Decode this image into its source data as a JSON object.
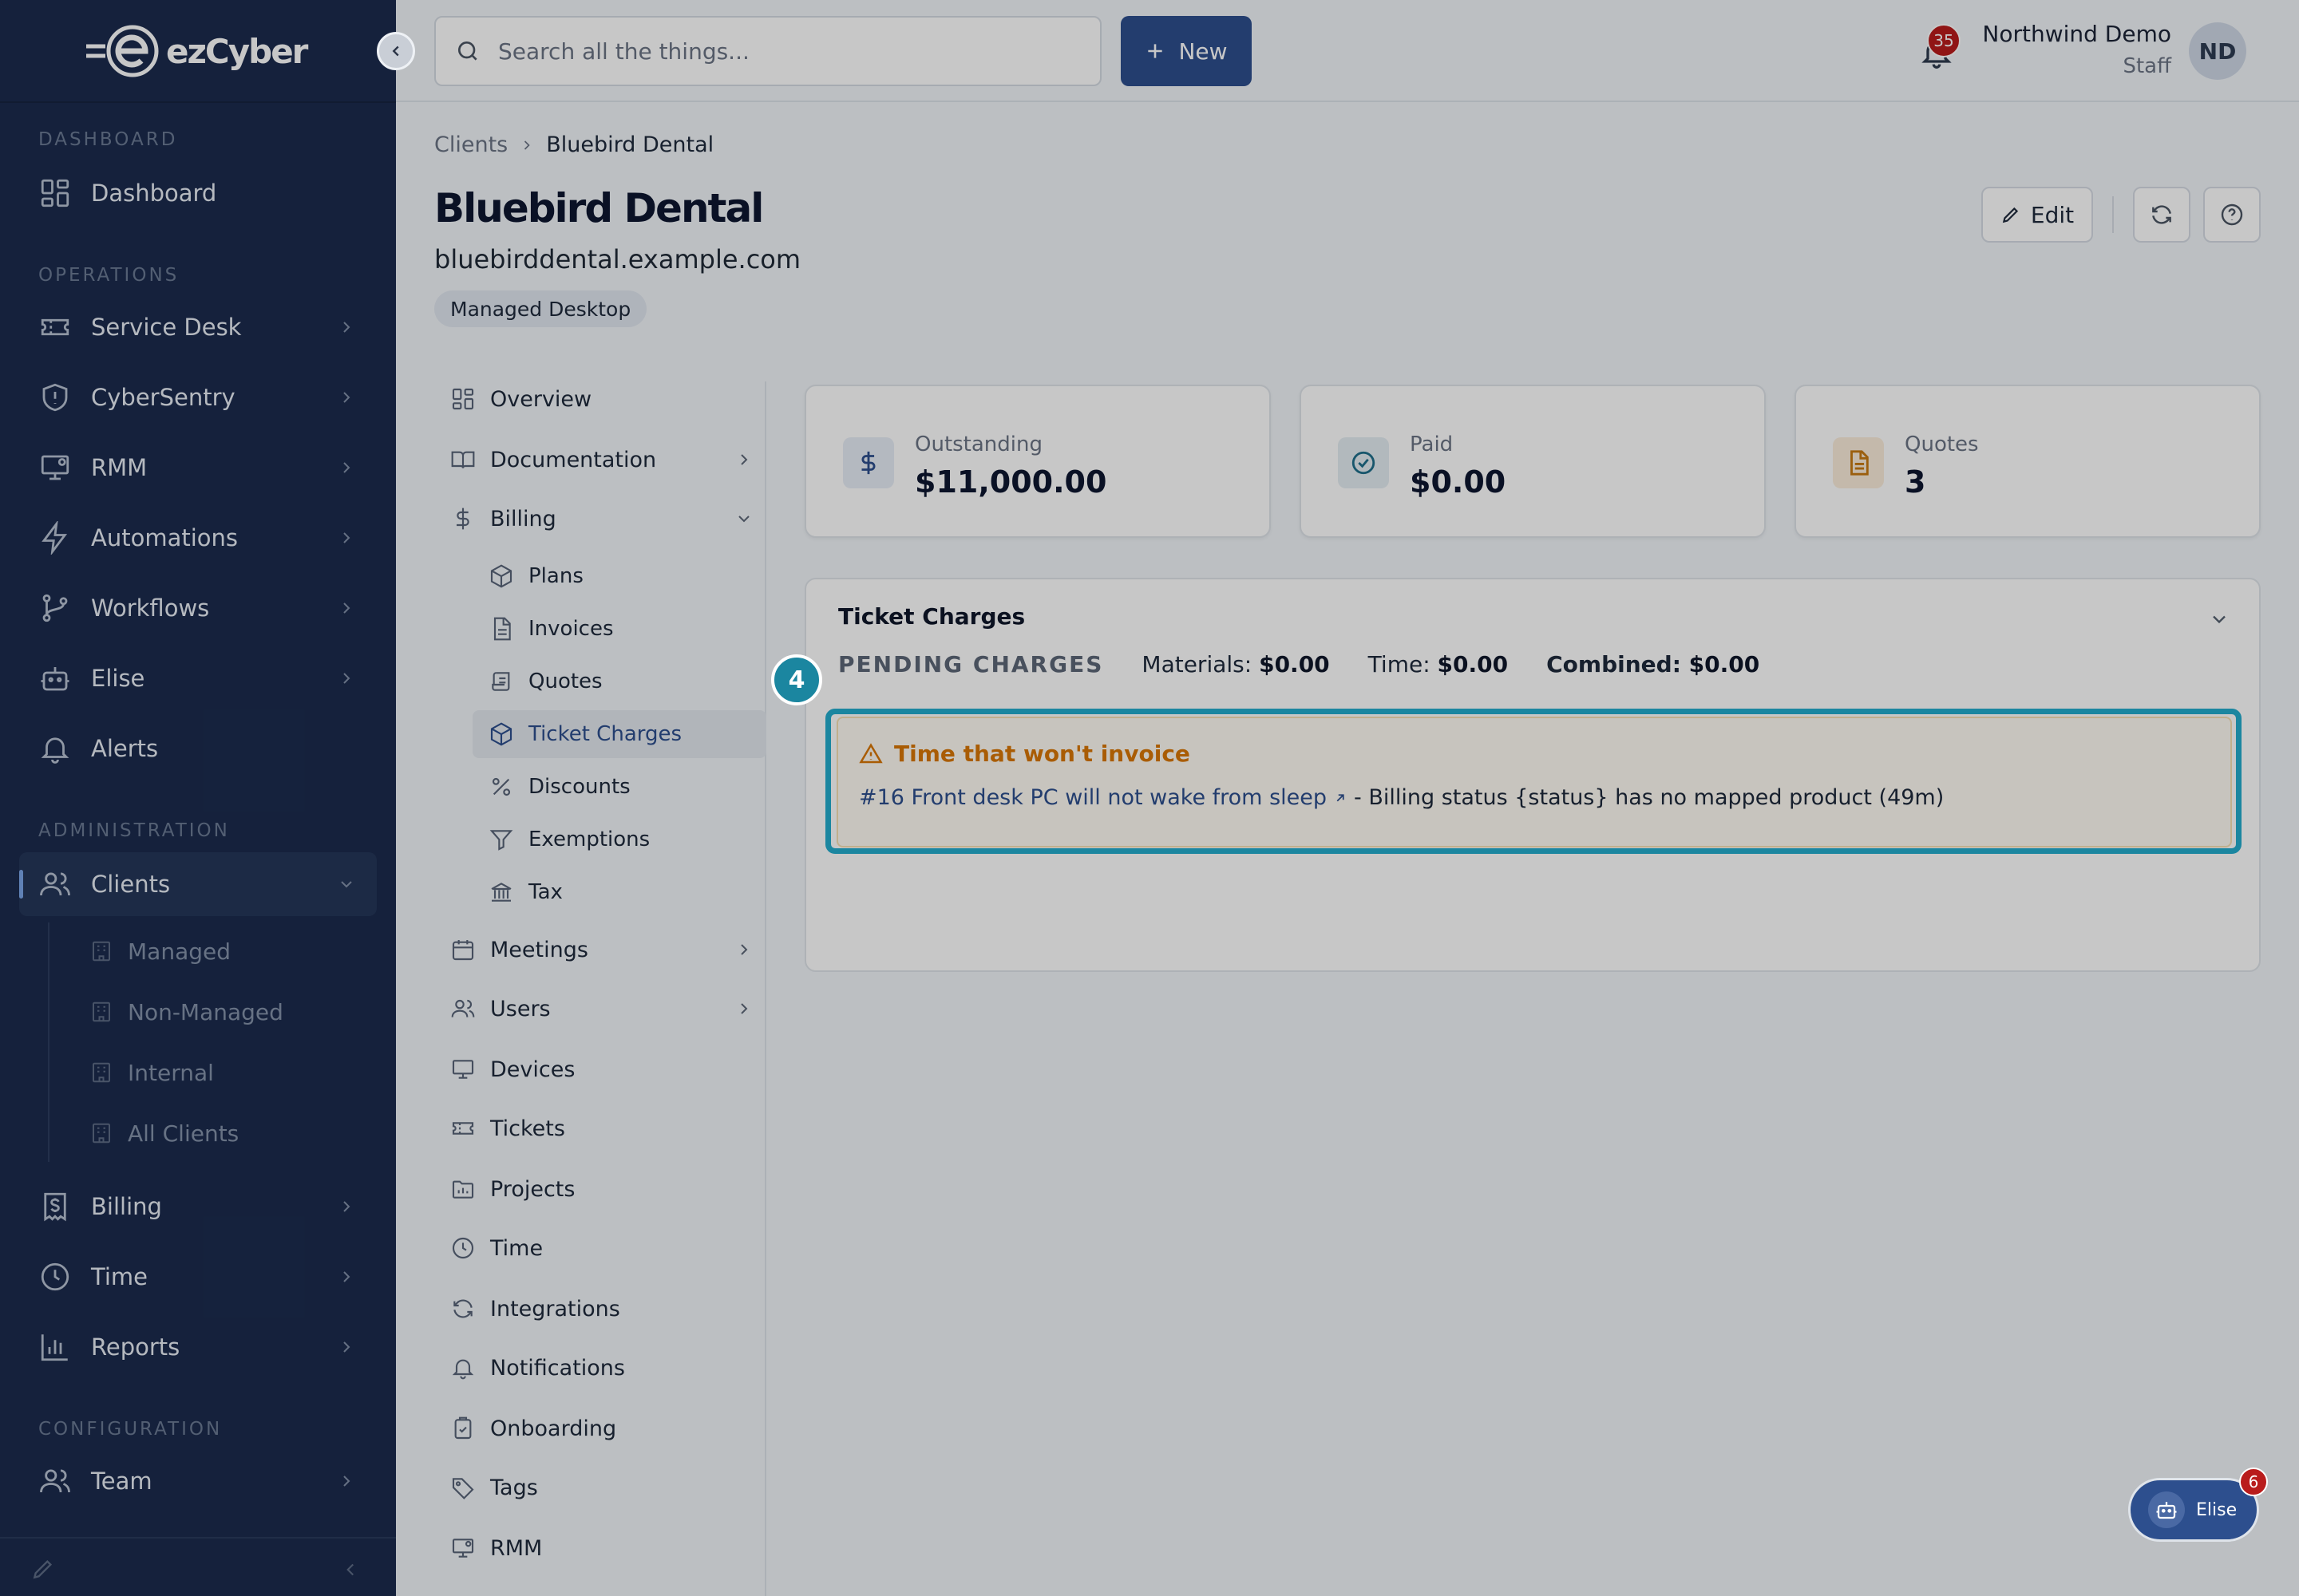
{
  "app": {
    "brand": "ezCyber"
  },
  "sidebar": {
    "sections": {
      "dashboard": "DASHBOARD",
      "operations": "OPERATIONS",
      "administration": "ADMINISTRATION",
      "configuration": "CONFIGURATION"
    },
    "items": {
      "dashboard": "Dashboard",
      "service_desk": "Service Desk",
      "cybersentry": "CyberSentry",
      "rmm": "RMM",
      "automations": "Automations",
      "workflows": "Workflows",
      "elise": "Elise",
      "alerts": "Alerts",
      "clients": "Clients",
      "billing": "Billing",
      "time": "Time",
      "reports": "Reports",
      "team": "Team"
    },
    "clients_children": [
      "Managed",
      "Non-Managed",
      "Internal",
      "All Clients"
    ]
  },
  "topbar": {
    "search_placeholder": "Search all the things...",
    "new_label": "New",
    "notification_count": "35",
    "user_name": "Northwind Demo",
    "user_role": "Staff",
    "user_initials": "ND"
  },
  "breadcrumb": [
    "Clients",
    "Bluebird Dental"
  ],
  "client": {
    "name": "Bluebird Dental",
    "domain": "bluebirddental.example.com",
    "tag": "Managed Desktop"
  },
  "actions": {
    "edit": "Edit"
  },
  "client_nav": {
    "overview": "Overview",
    "documentation": "Documentation",
    "billing": "Billing",
    "billing_children": [
      "Plans",
      "Invoices",
      "Quotes",
      "Ticket Charges",
      "Discounts",
      "Exemptions",
      "Tax"
    ],
    "meetings": "Meetings",
    "users": "Users",
    "devices": "Devices",
    "tickets": "Tickets",
    "projects": "Projects",
    "time": "Time",
    "integrations": "Integrations",
    "notifications": "Notifications",
    "onboarding": "Onboarding",
    "tags": "Tags",
    "rmm": "RMM"
  },
  "stats": {
    "outstanding": {
      "label": "Outstanding",
      "value": "$11,000.00"
    },
    "paid": {
      "label": "Paid",
      "value": "$0.00"
    },
    "quotes": {
      "label": "Quotes",
      "value": "3"
    }
  },
  "ticket_charges": {
    "title": "Ticket Charges",
    "pending_label": "PENDING CHARGES",
    "materials_label": "Materials:",
    "materials_value": "$0.00",
    "time_label": "Time:",
    "time_value": "$0.00",
    "combined_label": "Combined:",
    "combined_value": "$0.00",
    "warning_title": "Time that won't invoice",
    "warning_link": "#16 Front desk PC will not wake from sleep",
    "warning_detail": "- Billing status {status} has no mapped product (49m)"
  },
  "tour": {
    "step": "4"
  },
  "assistant": {
    "label": "Elise",
    "count": "6"
  },
  "colors": {
    "sidebar": "#1b2b4e",
    "primary": "#2d4f8e",
    "highlight": "#1b86a0",
    "warning": "#d97706"
  }
}
